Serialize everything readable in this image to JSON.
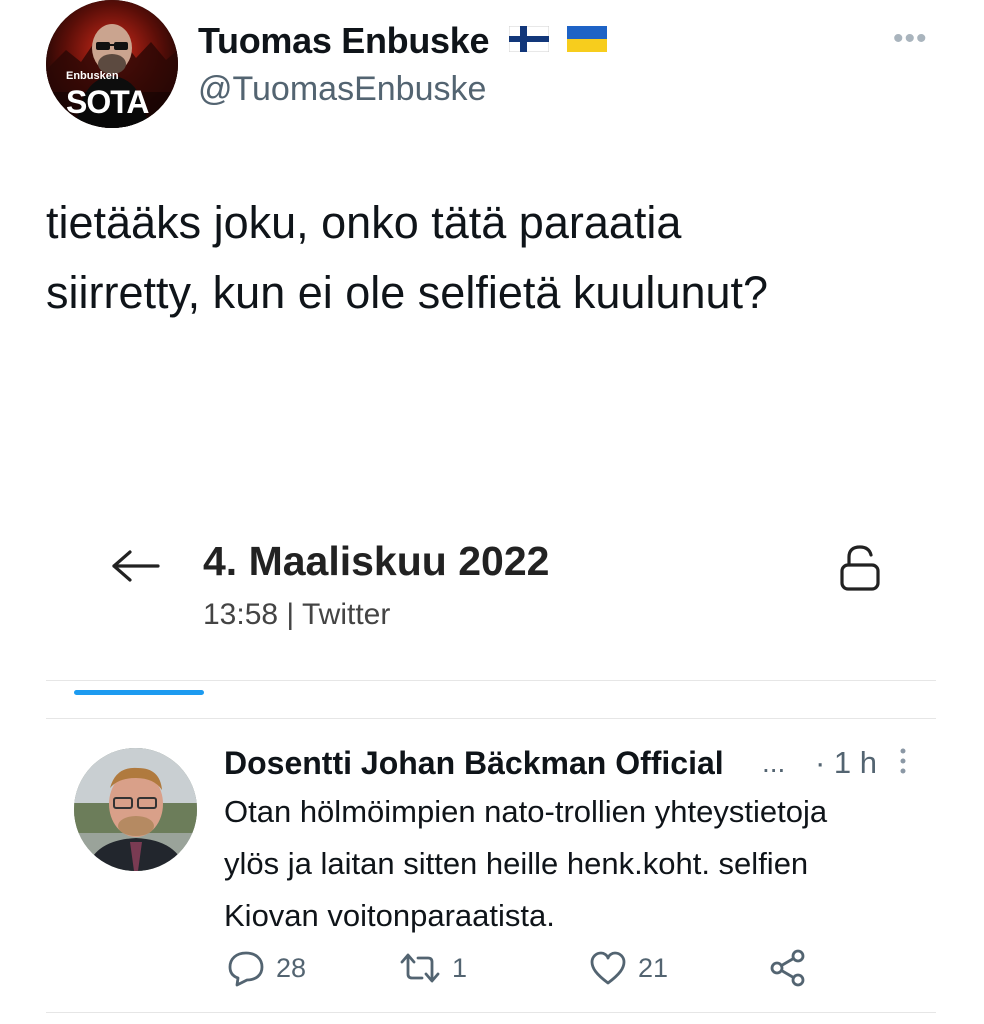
{
  "tweet": {
    "author": {
      "display_name": "Tuomas Enbuske",
      "handle": "@TuomasEnbuske",
      "avatar_small_text": "Enbusken",
      "avatar_big_text": "SOTA",
      "flags": [
        "finland-flag-icon",
        "ukraine-flag-icon"
      ]
    },
    "text_lines": [
      "tietääks joku, onko tätä paraatia",
      "siirretty, kun ei ole selfietä kuulunut?"
    ]
  },
  "embedded": {
    "header": {
      "date": "4. Maaliskuu 2022",
      "time_source": "13:58 | Twitter"
    },
    "reply": {
      "author": "Dosentti Johan Bäckman Official",
      "ellipsis": "...",
      "time": "· 1 h",
      "text_lines": [
        "Otan hölmöimpien nato-trollien yhteystietoja",
        "ylös ja laitan sitten heille henk.koht. selfien",
        "Kiovan voitonparaatista."
      ],
      "counts": {
        "replies": "28",
        "retweets": "1",
        "likes": "21"
      }
    }
  },
  "colors": {
    "accent": "#1d9bf0",
    "text": "#0f1419",
    "muted": "#536471"
  }
}
